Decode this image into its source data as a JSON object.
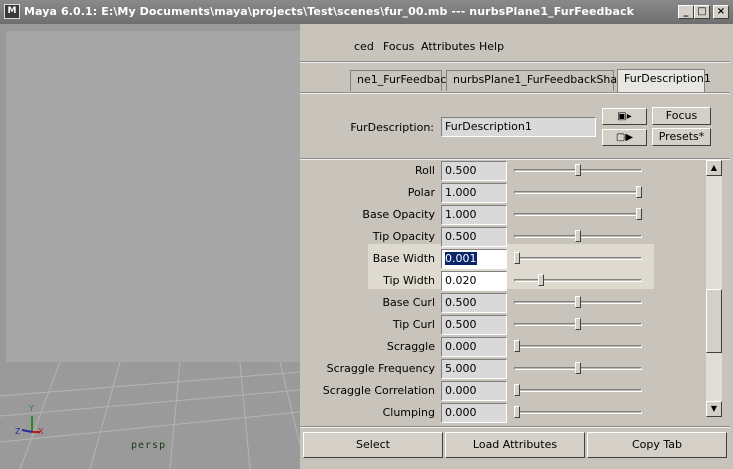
{
  "window": {
    "title": "Maya 6.0.1: E:\\My Documents\\maya\\projects\\Test\\scenes\\fur_00.mb   ---   nurbsPlane1_FurFeedback",
    "app_icon": "maya-icon",
    "controls": [
      "_",
      "□",
      "×"
    ]
  },
  "menu": [
    "ced",
    "Focus",
    "Attributes",
    "Help"
  ],
  "tabs": [
    {
      "label": "ne1_FurFeedback",
      "active": false
    },
    {
      "label": "nurbsPlane1_FurFeedbackShape",
      "active": false
    },
    {
      "label": "FurDescription1",
      "active": true
    }
  ],
  "description": {
    "label": "FurDescription:",
    "value": "FurDescription1"
  },
  "side_buttons": {
    "focus": "Focus",
    "presets": "Presets*",
    "in_icon": "input-connection-icon",
    "out_icon": "output-connection-icon"
  },
  "attributes": [
    {
      "label": "Roll",
      "value": "0.500",
      "level": 0.5
    },
    {
      "label": "Polar",
      "value": "1.000",
      "level": 1.0
    },
    {
      "label": "Base Opacity",
      "value": "1.000",
      "level": 1.0
    },
    {
      "label": "Tip Opacity",
      "value": "0.500",
      "level": 0.5
    },
    {
      "label": "Base Width",
      "value": "0.001",
      "level": 0.0,
      "editing": true,
      "selected": true
    },
    {
      "label": "Tip Width",
      "value": "0.020",
      "level": 0.2,
      "editing": true
    },
    {
      "label": "Base Curl",
      "value": "0.500",
      "level": 0.5
    },
    {
      "label": "Tip Curl",
      "value": "0.500",
      "level": 0.5
    },
    {
      "label": "Scraggle",
      "value": "0.000",
      "level": 0.0
    },
    {
      "label": "Scraggle Frequency",
      "value": "5.000",
      "level": 0.5
    },
    {
      "label": "Scraggle Correlation",
      "value": "0.000",
      "level": 0.0
    },
    {
      "label": "Clumping",
      "value": "0.000",
      "level": 0.0
    }
  ],
  "bottom_buttons": {
    "select": "Select",
    "load": "Load Attributes",
    "copy": "Copy Tab"
  },
  "viewport": {
    "camera": "persp",
    "axis_y": "Y",
    "axis_z": "Z",
    "axis_x": "X"
  },
  "colors": {
    "highlight": "#dedad0",
    "selection": "#0a246a"
  }
}
